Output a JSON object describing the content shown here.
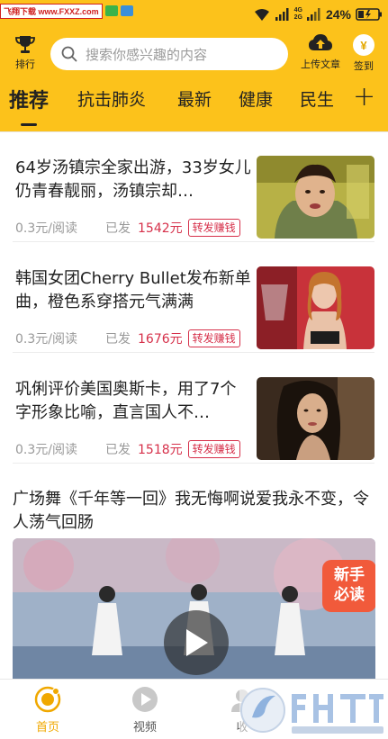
{
  "status_bar": {
    "watermark_text": "飞翔下载 www.FXXZ.com",
    "network": [
      "4G",
      "2G"
    ],
    "battery_percent": "24%"
  },
  "header": {
    "rank_label": "排行",
    "search_placeholder": "搜索你感兴趣的内容",
    "upload_label": "上传文章",
    "signin_label": "签到",
    "coin_symbol": "¥"
  },
  "tabs": [
    {
      "label": "推荐",
      "active": true
    },
    {
      "label": "抗击肺炎",
      "active": false
    },
    {
      "label": "最新",
      "active": false
    },
    {
      "label": "健康",
      "active": false
    },
    {
      "label": "民生",
      "active": false
    }
  ],
  "tab_more": "+",
  "feed": {
    "items": [
      {
        "title": "64岁汤镇宗全家出游，33岁女儿仍青春靓丽，汤镇宗却…",
        "rate": "0.3元/阅读",
        "sent_label": "已发",
        "amount": "1542元",
        "share_label": "转发赚钱"
      },
      {
        "title": "韩国女团Cherry Bullet发布新单曲，橙色系穿搭元气满满",
        "rate": "0.3元/阅读",
        "sent_label": "已发",
        "amount": "1676元",
        "share_label": "转发赚钱"
      },
      {
        "title": "巩俐评价美国奥斯卡，用了7个字形象比喻，直言国人不…",
        "rate": "0.3元/阅读",
        "sent_label": "已发",
        "amount": "1518元",
        "share_label": "转发赚钱"
      }
    ],
    "video": {
      "title": "广场舞《千年等一回》我无悔啊说爱我永不变，令人荡气回肠",
      "badge_line1": "新手",
      "badge_line2": "必读"
    }
  },
  "bottom_nav": [
    {
      "label": "首页",
      "active": true
    },
    {
      "label": "视频",
      "active": false
    },
    {
      "label": "收",
      "active": false
    }
  ],
  "colors": {
    "brand_yellow": "#fcc21b",
    "accent_red": "#d6304a",
    "badge_orange": "#f15a3b",
    "nav_active": "#f0a800"
  }
}
